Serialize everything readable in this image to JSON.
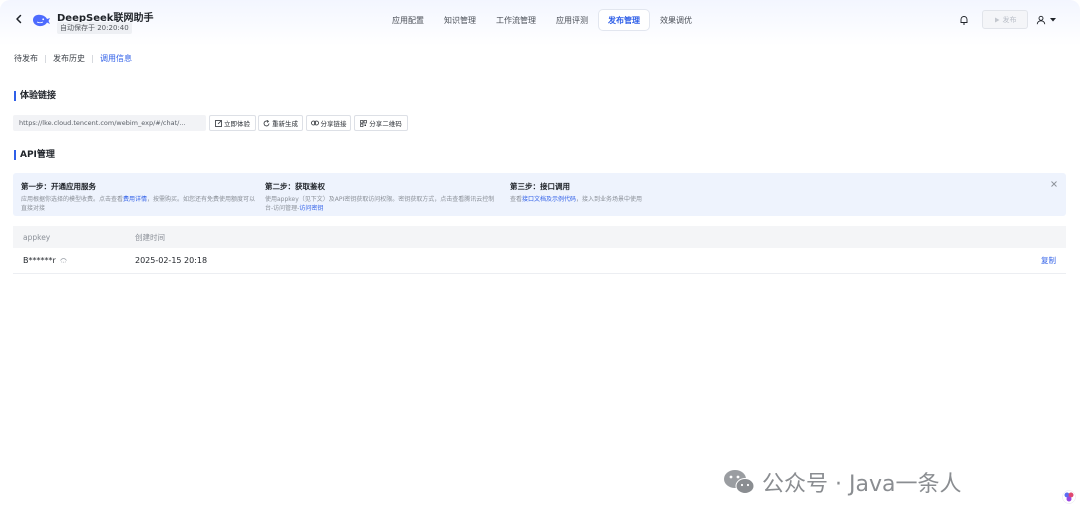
{
  "header": {
    "app_title": "DeepSeek联网助手",
    "autosave": "自动保存于 20:20:40",
    "nav": [
      "应用配置",
      "知识管理",
      "工作流管理",
      "应用评测",
      "发布管理",
      "效果调优"
    ],
    "active_nav": "发布管理",
    "publish_label": "发布"
  },
  "subtabs": {
    "items": [
      "待发布",
      "发布历史",
      "调用信息"
    ],
    "active": "调用信息"
  },
  "experience": {
    "title": "体验链接",
    "url": "https://lke.cloud.tencent.com/webim_exp/#/chat/...",
    "buttons": [
      "立即体验",
      "重新生成",
      "分享链接",
      "分享二维码"
    ]
  },
  "api": {
    "title": "API管理",
    "steps": [
      {
        "title": "第一步：开通应用服务",
        "desc_pre": "应用根据你选择的模型收费。点击查看",
        "desc_link": "费用详情",
        "desc_post": "，按需购买。如您还有免费使用额度可以直接对接"
      },
      {
        "title": "第二步：获取鉴权",
        "desc_pre": "使用appkey（见下文）及API密钥获取访问权限。密钥获取方式，点击查看腾讯云控制台-访问管理-",
        "desc_link": "访问密钥",
        "desc_post": ""
      },
      {
        "title": "第三步：接口调用",
        "desc_pre": "查看",
        "desc_link": "接口文档及示例代码",
        "desc_post": "，接入到业务场景中使用"
      }
    ],
    "table": {
      "headers": [
        "appkey",
        "创建时间"
      ],
      "rows": [
        {
          "appkey": "B******r",
          "created": "2025-02-15 20:18",
          "action": "复制"
        }
      ]
    }
  },
  "watermark": "公众号 · Java一条人",
  "colors": {
    "accent": "#2f5fe8",
    "panel": "#eef3fd"
  }
}
